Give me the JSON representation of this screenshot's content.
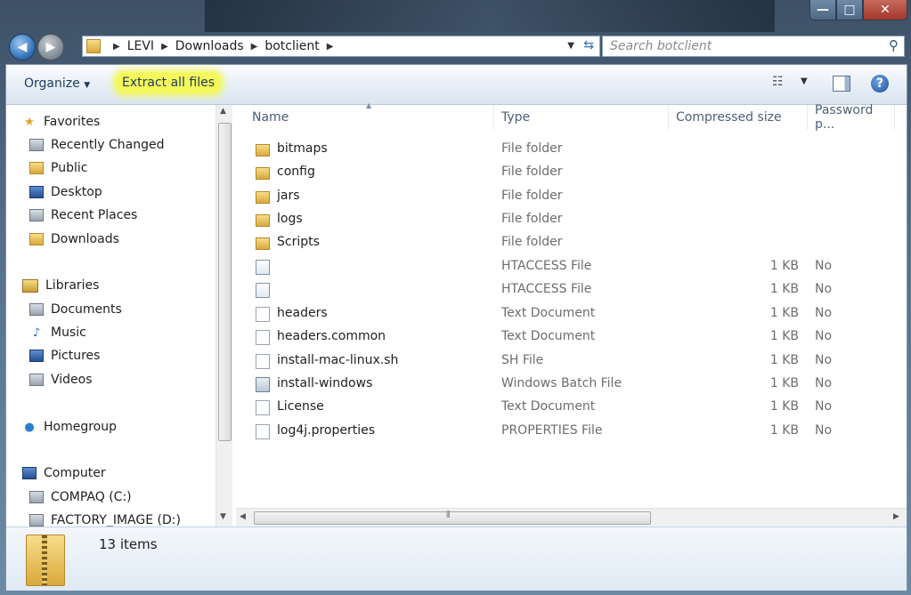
{
  "window": {
    "min_glyph": "—",
    "max_glyph": "□",
    "close_glyph": "✕"
  },
  "address": {
    "crumbs": [
      "LEVI",
      "Downloads",
      "botclient"
    ],
    "search_placeholder": "Search botclient"
  },
  "toolbar": {
    "organize": "Organize",
    "extract": "Extract all files"
  },
  "nav": {
    "favorites": "Favorites",
    "recently_changed": "Recently Changed",
    "public": "Public",
    "desktop": "Desktop",
    "recent_places": "Recent Places",
    "downloads": "Downloads",
    "libraries": "Libraries",
    "documents": "Documents",
    "music": "Music",
    "pictures": "Pictures",
    "videos": "Videos",
    "homegroup": "Homegroup",
    "computer": "Computer",
    "drive_c": "COMPAQ (C:)",
    "drive_d": "FACTORY_IMAGE (D:)"
  },
  "columns": {
    "name": "Name",
    "type": "Type",
    "compressed": "Compressed size",
    "password": "Password p..."
  },
  "files": [
    {
      "name": "bitmaps",
      "type": "File folder",
      "size": "",
      "password": "",
      "icon": "folder"
    },
    {
      "name": "config",
      "type": "File folder",
      "size": "",
      "password": "",
      "icon": "folder"
    },
    {
      "name": "jars",
      "type": "File folder",
      "size": "",
      "password": "",
      "icon": "folder"
    },
    {
      "name": "logs",
      "type": "File folder",
      "size": "",
      "password": "",
      "icon": "folder"
    },
    {
      "name": "Scripts",
      "type": "File folder",
      "size": "",
      "password": "",
      "icon": "folder"
    },
    {
      "name": "",
      "type": "HTACCESS File",
      "size": "1 KB",
      "password": "No",
      "icon": "htaccess"
    },
    {
      "name": "",
      "type": "HTACCESS File",
      "size": "1 KB",
      "password": "No",
      "icon": "htaccess"
    },
    {
      "name": "headers",
      "type": "Text Document",
      "size": "1 KB",
      "password": "No",
      "icon": "doc"
    },
    {
      "name": "headers.common",
      "type": "Text Document",
      "size": "1 KB",
      "password": "No",
      "icon": "doc"
    },
    {
      "name": "install-mac-linux.sh",
      "type": "SH File",
      "size": "1 KB",
      "password": "No",
      "icon": "doc"
    },
    {
      "name": "install-windows",
      "type": "Windows Batch File",
      "size": "1 KB",
      "password": "No",
      "icon": "batch"
    },
    {
      "name": "License",
      "type": "Text Document",
      "size": "1 KB",
      "password": "No",
      "icon": "doc"
    },
    {
      "name": "log4j.properties",
      "type": "PROPERTIES File",
      "size": "1 KB",
      "password": "No",
      "icon": "doc"
    }
  ],
  "status": {
    "count": "13 items"
  }
}
